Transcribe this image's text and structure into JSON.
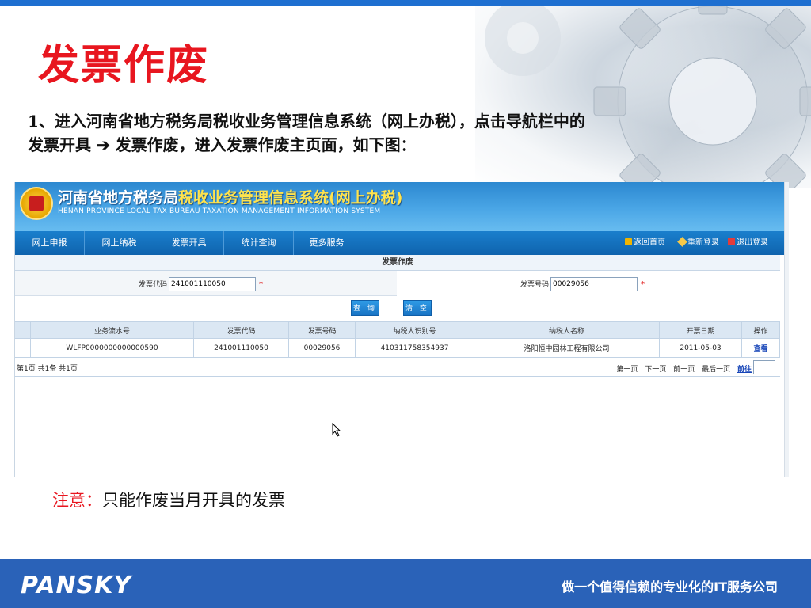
{
  "slide": {
    "title": "发票作废",
    "intro_line1": "1、进入河南省地方税务局税收业务管理信息系统（网上办税），点击导航栏中的",
    "intro_line2": "发票开具 ➔ 发票作废，进入发票作废主页面，如下图：",
    "note_label": "注意：",
    "note_text": "只能作废当月开具的发票"
  },
  "system": {
    "title_main": "河南省地方税务局",
    "title_highlight": "税收业务管理信息系统(网上办税)",
    "subtitle": "HENAN PROVINCE LOCAL TAX  BUREAU TAXATION MANAGEMENT INFORMATION SYSTEM"
  },
  "nav": {
    "items": [
      "网上申报",
      "网上纳税",
      "发票开具",
      "统计查询",
      "更多服务"
    ],
    "home": "返回首页",
    "relogin": "重新登录",
    "logout": "退出登录"
  },
  "form": {
    "section_title": "发票作废",
    "code_label": "发票代码",
    "code_value": "241001110050",
    "number_label": "发票号码",
    "number_value": "00029056",
    "required_mark": "*",
    "query_button": "查 询",
    "clear_button": "清 空"
  },
  "table": {
    "headers": [
      "业务流水号",
      "发票代码",
      "发票号码",
      "纳税人识别号",
      "纳税人名称",
      "开票日期",
      "操作"
    ],
    "rows": [
      [
        "WLFP0000000000000590",
        "241001110050",
        "00029056",
        "410311758354937",
        "洛阳恒中园林工程有限公司",
        "2011-05-03",
        "查看"
      ]
    ]
  },
  "pager": {
    "summary": "第1页 共1条 共1页",
    "first": "第一页",
    "next": "下一页",
    "prev": "前一页",
    "last": "最后一页",
    "go": "前往"
  },
  "footer": {
    "logo": "PANSKY",
    "slogan": "做一个值得信赖的专业化的IT服务公司"
  },
  "colors": {
    "title_red": "#e8161f",
    "footer_blue": "#2a62b8",
    "nav_blue": "#0f63ad"
  }
}
